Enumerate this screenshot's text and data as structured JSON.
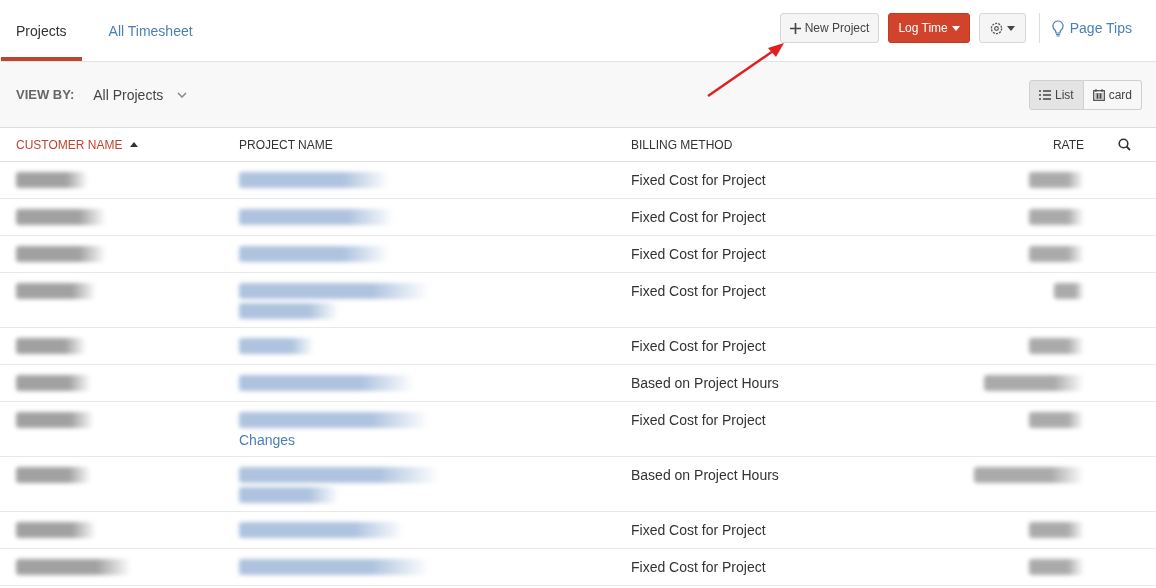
{
  "tabs": [
    {
      "label": "Projects",
      "selected": true
    },
    {
      "label": "All Timesheet",
      "selected": false
    }
  ],
  "toolbar": {
    "new_project": "New Project",
    "log_time": "Log Time",
    "page_tips": "Page Tips"
  },
  "filter": {
    "label": "VIEW BY:",
    "value": "All Projects"
  },
  "view_toggle": [
    {
      "label": "List",
      "kind": "list",
      "selected": true
    },
    {
      "label": "card",
      "kind": "card",
      "selected": false
    }
  ],
  "table": {
    "columns": [
      {
        "label": "CUSTOMER NAME",
        "sorted": true
      },
      {
        "label": "PROJECT NAME",
        "sorted": false
      },
      {
        "label": "BILLING METHOD",
        "sorted": false
      },
      {
        "label": "RATE",
        "sorted": false
      }
    ],
    "rows": [
      {
        "customer": {
          "kind": "blurred"
        },
        "project": [
          {
            "kind": "blurred"
          }
        ],
        "billing": "Fixed Cost for Project",
        "rate": {
          "kind": "blurred"
        }
      },
      {
        "customer": {
          "kind": "blurred"
        },
        "project": [
          {
            "kind": "blurred"
          }
        ],
        "billing": "Fixed Cost for Project",
        "rate": {
          "kind": "blurred"
        }
      },
      {
        "customer": {
          "kind": "blurred"
        },
        "project": [
          {
            "kind": "blurred"
          }
        ],
        "billing": "Fixed Cost for Project",
        "rate": {
          "kind": "blurred"
        }
      },
      {
        "customer": {
          "kind": "blurred"
        },
        "project": [
          {
            "kind": "blurred"
          },
          {
            "kind": "blurred"
          }
        ],
        "billing": "Fixed Cost for Project",
        "rate": {
          "kind": "blurred"
        }
      },
      {
        "customer": {
          "kind": "blurred"
        },
        "project": [
          {
            "kind": "blurred"
          }
        ],
        "billing": "Fixed Cost for Project",
        "rate": {
          "kind": "blurred"
        }
      },
      {
        "customer": {
          "kind": "blurred"
        },
        "project": [
          {
            "kind": "blurred"
          }
        ],
        "billing": "Based on Project Hours",
        "rate": {
          "kind": "blurred"
        }
      },
      {
        "customer": {
          "kind": "blurred"
        },
        "project": [
          {
            "kind": "blurred"
          },
          {
            "kind": "text",
            "text": "Changes"
          }
        ],
        "billing": "Fixed Cost for Project",
        "rate": {
          "kind": "blurred"
        }
      },
      {
        "customer": {
          "kind": "blurred"
        },
        "project": [
          {
            "kind": "blurred"
          },
          {
            "kind": "blurred"
          }
        ],
        "billing": "Based on Project Hours",
        "rate": {
          "kind": "blurred"
        }
      },
      {
        "customer": {
          "kind": "blurred"
        },
        "project": [
          {
            "kind": "blurred"
          }
        ],
        "billing": "Fixed Cost for Project",
        "rate": {
          "kind": "blurred"
        }
      },
      {
        "customer": {
          "kind": "blurred"
        },
        "project": [
          {
            "kind": "blurred"
          }
        ],
        "billing": "Fixed Cost for Project",
        "rate": {
          "kind": "blurred"
        }
      }
    ]
  }
}
